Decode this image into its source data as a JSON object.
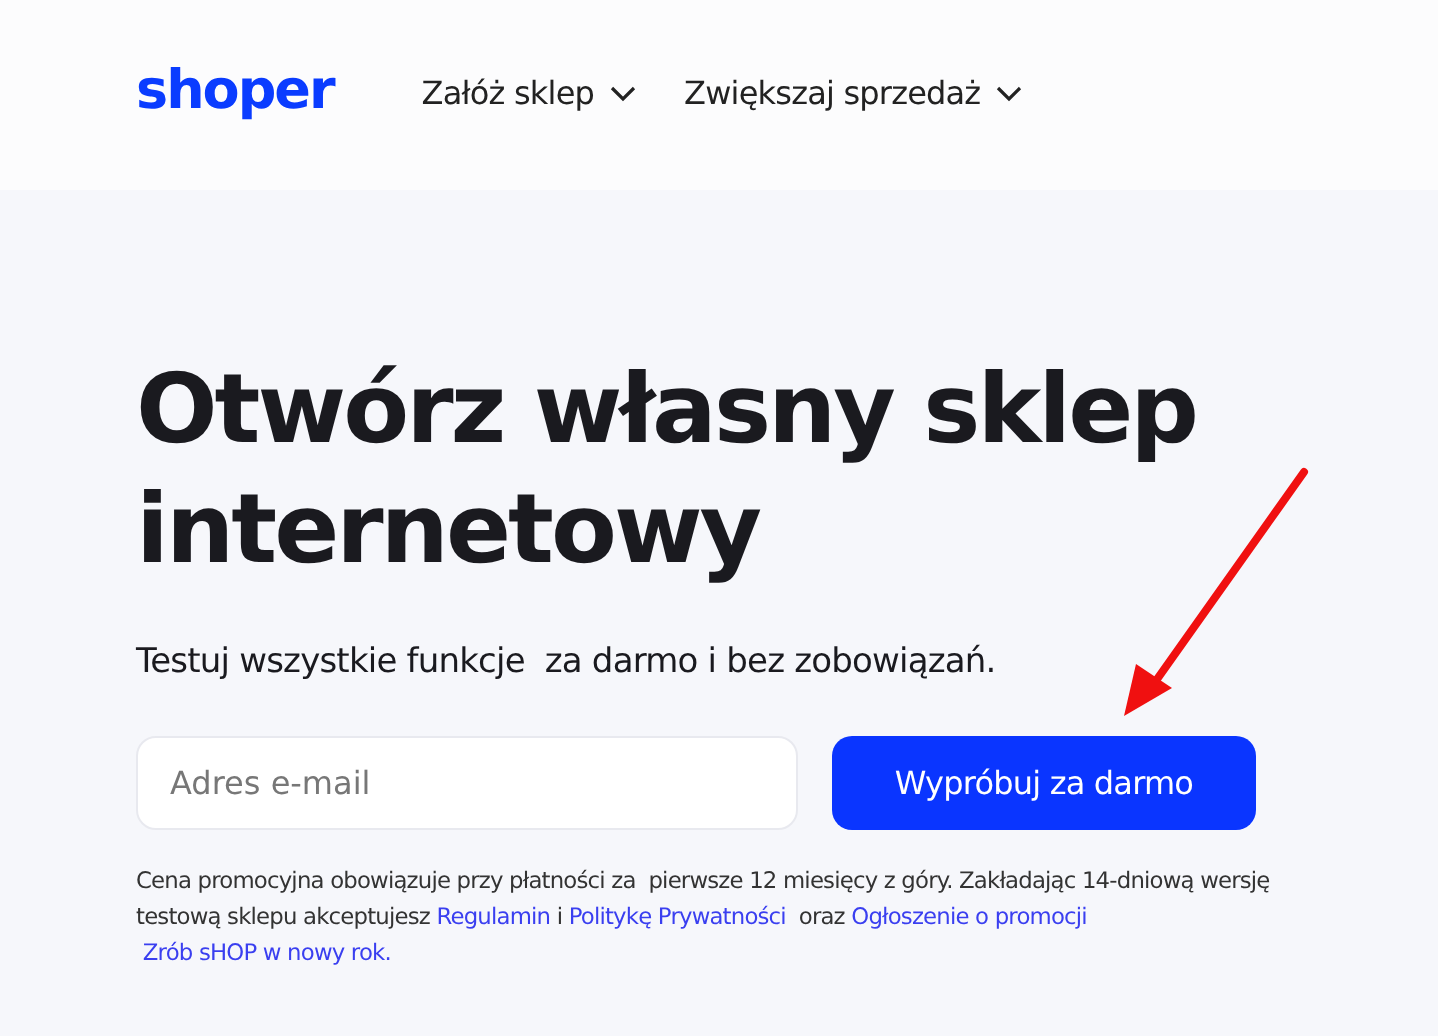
{
  "header": {
    "logo": "shoper",
    "nav": [
      {
        "label": "Załóż sklep"
      },
      {
        "label": "Zwiększaj sprzedaż"
      }
    ]
  },
  "hero": {
    "title": "Otwórz własny sklep internetowy",
    "subtitle": "Testuj wszystkie funkcje  za darmo i bez zobowiązań.",
    "email_field": {
      "placeholder": "Adres e-mail"
    },
    "button": "Wypróbuj za darmo",
    "disclaimer": [
      {
        "kind": "text",
        "text": "Cena promocyjna obowiązuje przy płatności za  pierwsze 12 miesięcy z góry. Zakładając 14-dniową wersję testową sklepu akceptujesz "
      },
      {
        "kind": "link",
        "text": "Regulamin"
      },
      {
        "kind": "text",
        "text": " i "
      },
      {
        "kind": "link",
        "text": "Politykę Prywatności"
      },
      {
        "kind": "text",
        "text": "  oraz "
      },
      {
        "kind": "link",
        "text": "Ogłoszenie o promocji"
      },
      {
        "kind": "link",
        "text": "Zrób sHOP w nowy rok."
      }
    ]
  }
}
